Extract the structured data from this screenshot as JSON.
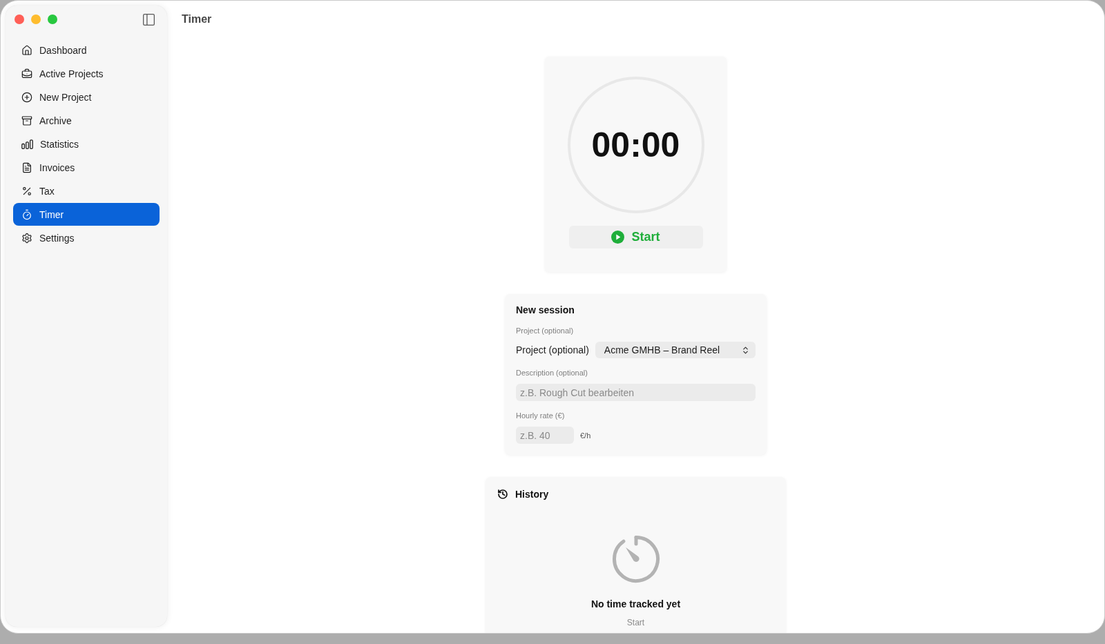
{
  "window": {
    "title": "Timer"
  },
  "sidebar": {
    "items": [
      {
        "label": "Dashboard",
        "selected": false
      },
      {
        "label": "Active Projects",
        "selected": false
      },
      {
        "label": "New Project",
        "selected": false
      },
      {
        "label": "Archive",
        "selected": false
      },
      {
        "label": "Statistics",
        "selected": false
      },
      {
        "label": "Invoices",
        "selected": false
      },
      {
        "label": "Tax",
        "selected": false
      },
      {
        "label": "Timer",
        "selected": true
      },
      {
        "label": "Settings",
        "selected": false
      }
    ]
  },
  "timer": {
    "time": "00:00",
    "start_button": "Start"
  },
  "new_session": {
    "title": "New session",
    "fields": [
      {
        "kind": "select",
        "label": "Project (optional)",
        "control_label": "Project (optional)",
        "value": "Acme GMHB – Brand Reel"
      },
      {
        "kind": "text",
        "label": "Description (optional)",
        "placeholder": "z.B. Rough Cut bearbeiten"
      },
      {
        "kind": "number",
        "label": "Hourly rate (€)",
        "placeholder": "z.B. 40",
        "unit": "€/h"
      }
    ]
  },
  "history": {
    "title": "History",
    "empty_state": {
      "title": "No time tracked yet",
      "action": "Start"
    }
  }
}
